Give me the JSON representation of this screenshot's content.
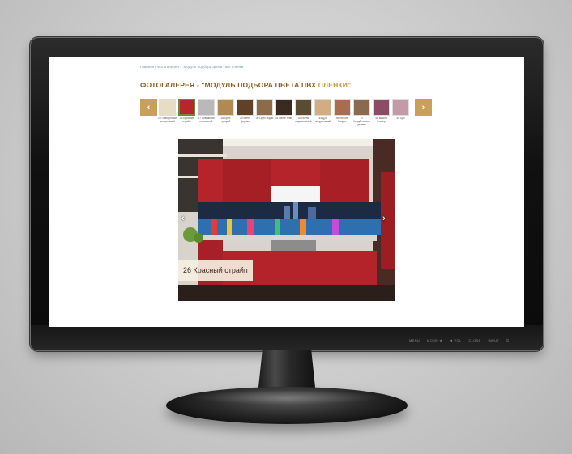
{
  "breadcrumb": {
    "home": "Главная",
    "separator": " / ",
    "current": "Фотогалерея - \"Модуль подбора цвета ПВХ пленки\""
  },
  "page_title": {
    "main": "ФОТОГАЛЕРЕЯ - \"МОДУЛЬ ПОДБОРА ЦВЕТА ПВХ",
    "accent": "ПЛЕНКИ\""
  },
  "carousel": {
    "prev_icon": "chevron-left-icon",
    "next_icon": "chevron-right-icon",
    "swatches": [
      {
        "label": "24 Поворотный эмпирейский",
        "color": "#e7dcc4"
      },
      {
        "label": "26 Красный страйп",
        "color": "#b7262c",
        "active": true
      },
      {
        "label": "27 Алюминий полосатый",
        "color": "#b9b9bc"
      },
      {
        "label": "28 Орех грецкий",
        "color": "#b08a55"
      },
      {
        "label": "29 Венге ферако",
        "color": "#5f4128"
      },
      {
        "label": "30 Орех седой",
        "color": "#8a6d47"
      },
      {
        "label": "31 Венге темн",
        "color": "#3a2a1f"
      },
      {
        "label": "32 Ясень карамельный",
        "color": "#5a4b33"
      },
      {
        "label": "44 Дуб натуральный",
        "color": "#d3ad82"
      },
      {
        "label": "46 Яблоня Голдон",
        "color": "#a96c4e"
      },
      {
        "label": "47 Хендбельское дерево",
        "color": "#8a6a4e"
      },
      {
        "label": "48 Вишня Клинер",
        "color": "#8c4c66"
      },
      {
        "label": "49 Орх",
        "color": "#c59aa8"
      }
    ]
  },
  "gallery": {
    "caption": "26 Красный страйп",
    "prev_icon": "chevron-left-icon",
    "next_icon": "chevron-right-icon"
  },
  "monitor": {
    "controls": [
      "MENU",
      "MODE ◄",
      "◄ VOL",
      "CLOSE",
      "INPUT",
      "⏻"
    ]
  }
}
